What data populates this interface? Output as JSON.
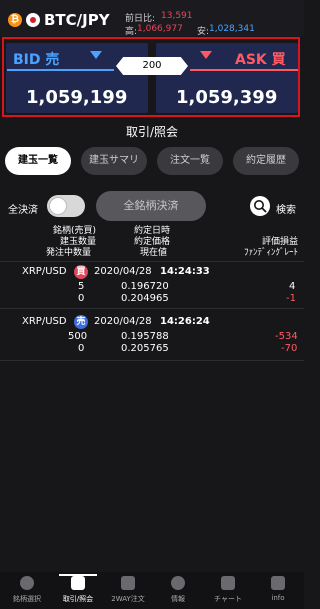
{
  "header": {
    "pair": "BTC/JPY",
    "prev_day_label": "前日比:",
    "prev_day_value": "13,591",
    "high_label": "高:",
    "high_value": "1,066,977",
    "low_label": "安:",
    "low_value": "1,028,341"
  },
  "quote": {
    "bid_label": "BID 売",
    "ask_label": "ASK 買",
    "spread": "200",
    "bid_price": "1,059,199",
    "ask_price": "1,059,399"
  },
  "section_title": "取引/照会",
  "tabs": [
    {
      "label": "建玉一覧"
    },
    {
      "label": "建玉サマリ"
    },
    {
      "label": "注文一覧"
    },
    {
      "label": "約定履歴"
    }
  ],
  "controls": {
    "settle_all_label": "全決済",
    "settle_all_button": "全銘柄決済",
    "search_label": "検索"
  },
  "columns": {
    "left": [
      "銘柄(売買)",
      "建玉数量",
      "発注中数量"
    ],
    "middle": [
      "約定日時",
      "約定価格",
      "現在値"
    ],
    "right": [
      "評価損益",
      "ﾌｧﾝﾃﾞｨﾝｸﾞﾚｰﾄ"
    ]
  },
  "positions": [
    {
      "symbol": "XRP/USD",
      "side": "買",
      "date": "2020/04/28",
      "time": "14:24:33",
      "qty": "5",
      "exec_price": "0.196720",
      "pnl": "4",
      "pending": "0",
      "current": "0.204965",
      "funding": "-1"
    },
    {
      "symbol": "XRP/USD",
      "side": "売",
      "date": "2020/04/28",
      "time": "14:26:24",
      "qty": "500",
      "exec_price": "0.195788",
      "pnl": "-534",
      "pending": "0",
      "current": "0.205765",
      "funding": "-70"
    }
  ],
  "bottom_nav": [
    {
      "label": "銘柄選択"
    },
    {
      "label": "取引/照会"
    },
    {
      "label": "2WAY注文"
    },
    {
      "label": "情報"
    },
    {
      "label": "チャート"
    },
    {
      "label": "info"
    }
  ]
}
